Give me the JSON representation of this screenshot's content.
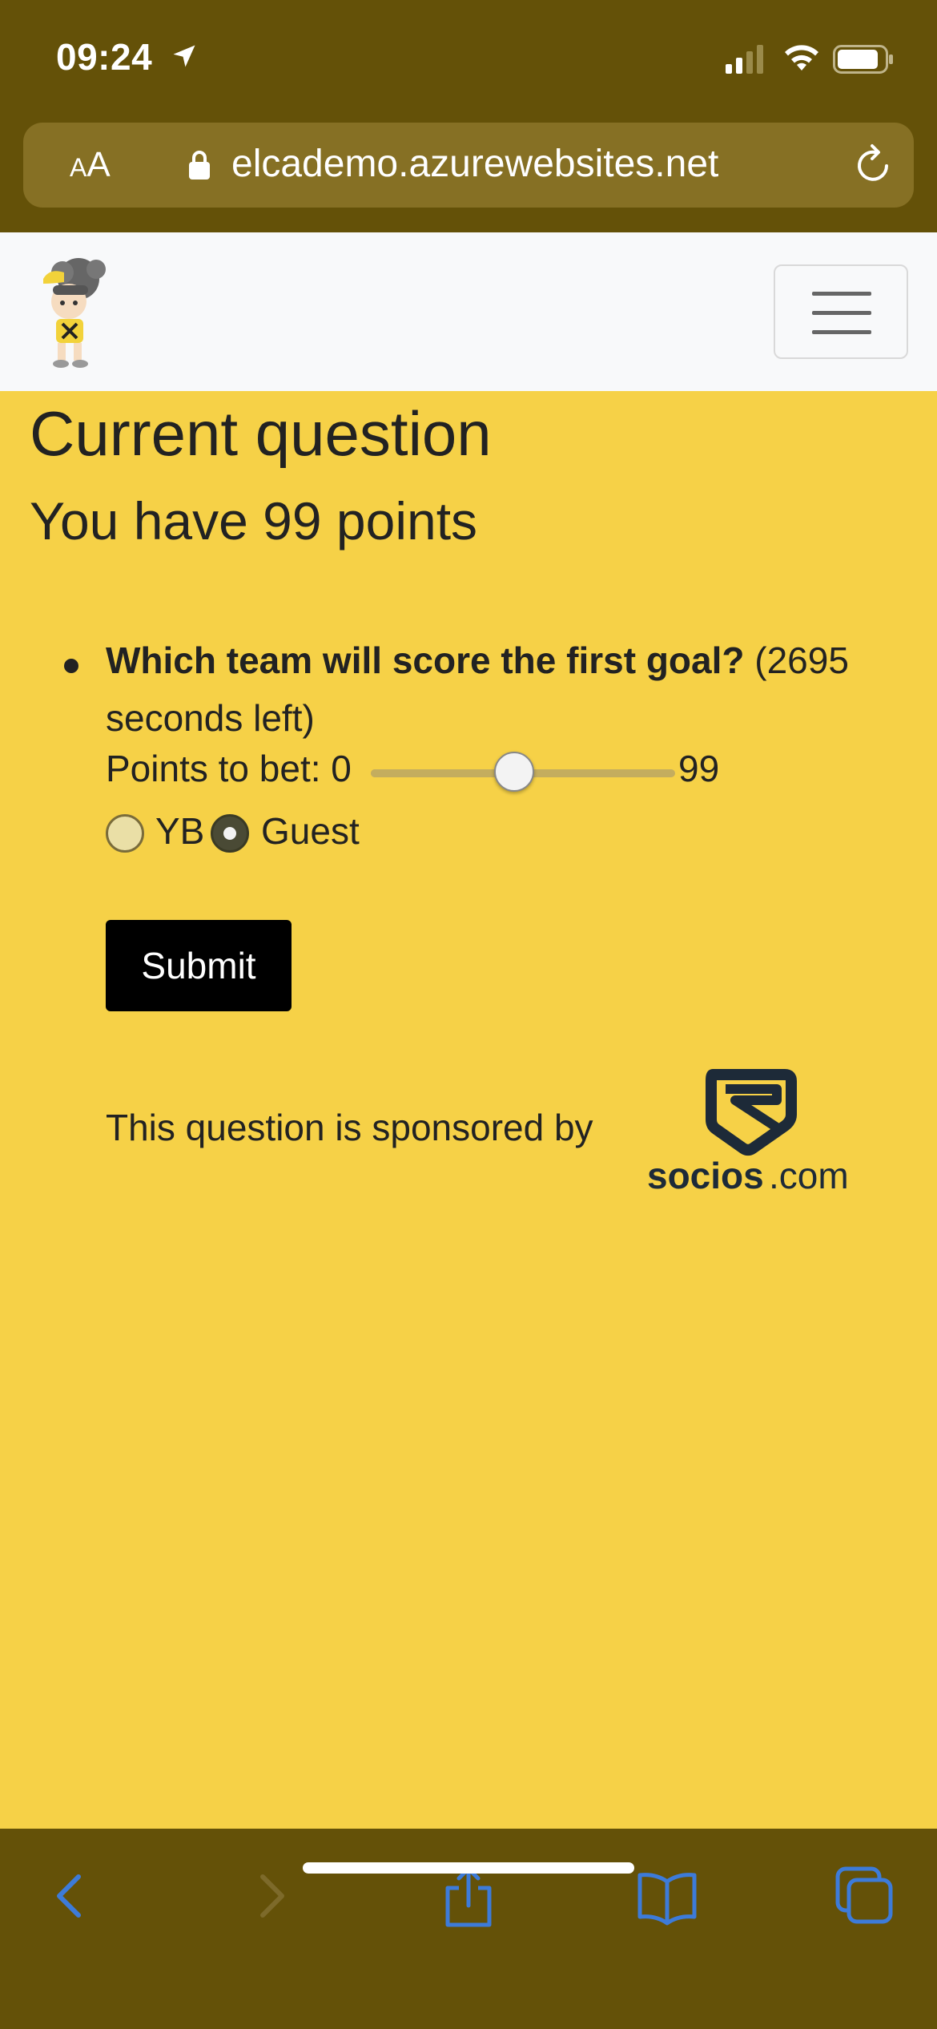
{
  "status_bar": {
    "time": "09:24",
    "icons": [
      "location-arrow-icon",
      "cellular-signal-icon",
      "wifi-icon",
      "battery-icon"
    ]
  },
  "browser": {
    "text_size_label_small": "A",
    "text_size_label_large": "A",
    "url": "elcademo.azurewebsites.net",
    "icons": [
      "lock-icon",
      "reload-icon"
    ],
    "toolbar_icons": [
      "back-icon",
      "forward-icon",
      "share-icon",
      "bookmarks-icon",
      "tabs-icon"
    ]
  },
  "navbar": {
    "logo_icon": "mascot-logo",
    "menu_icon": "hamburger-icon"
  },
  "page": {
    "heading": "Current question",
    "points_text": "You have 99 points",
    "question_bold": "Which team will score the first goal?",
    "question_rest": " (2695 seconds left)",
    "bet_label": "Points to bet: 0",
    "bet_max": "99",
    "bet_min_value": 0,
    "bet_max_value": 99,
    "bet_level_fraction": 0.47,
    "options": [
      "YB",
      "Guest"
    ],
    "selected_option": "Guest",
    "submit_label": "Submit",
    "sponsor_text": "This question is sponsored by",
    "sponsor_logo_text": "socios.com"
  },
  "colors": {
    "page_background": "#f6d147",
    "browser_chrome": "#645108",
    "url_bar": "#867024",
    "navbar_background": "#f8f9fa",
    "submit_background": "#000000",
    "toolbar_icon": "#3d7bd9"
  }
}
